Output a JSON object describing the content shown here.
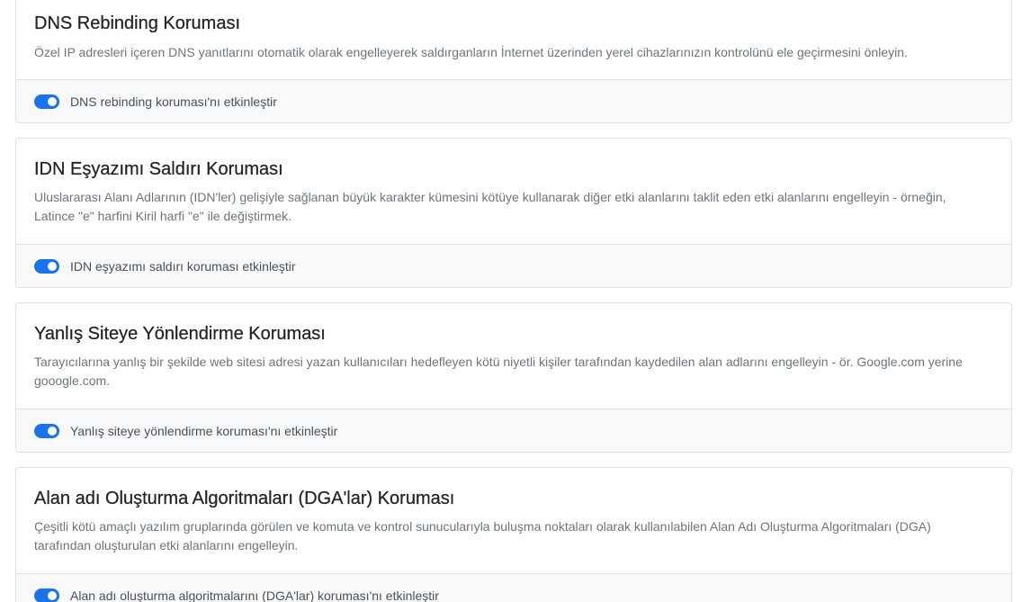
{
  "cards": [
    {
      "title": "DNS Rebinding Koruması",
      "description": "Özel IP adresleri içeren DNS yanıtlarını otomatik olarak engelleyerek saldırganların İnternet üzerinden yerel cihazlarınızın kontrolünü ele geçirmesini önleyin.",
      "toggle_label": "DNS rebinding koruması'nı etkinleştir",
      "enabled": true
    },
    {
      "title": "IDN Eşyazımı Saldırı Koruması",
      "description": "Uluslararası Alanı Adlarının (IDN'ler) gelişiyle sağlanan büyük karakter kümesini kötüye kullanarak diğer etki alanlarını taklit eden etki alanlarını engelleyin - örneğin, Latince \"e\" harfini Kiril harfi \"е\" ile değiştirmek.",
      "toggle_label": "IDN eşyazımı saldırı koruması etkinleştir",
      "enabled": true
    },
    {
      "title": "Yanlış Siteye Yönlendirme Koruması",
      "description": "Tarayıcılarına yanlış bir şekilde web sitesi adresi yazan kullanıcıları hedefleyen kötü niyetli kişiler tarafından kaydedilen alan adlarını engelleyin - ör. Google.com yerine gooogle.com.",
      "toggle_label": "Yanlış siteye yönlendirme koruması'nı etkinleştir",
      "enabled": true
    },
    {
      "title": "Alan adı Oluşturma Algoritmaları (DGA'lar) Koruması",
      "description": "Çeşitli kötü amaçlı yazılım gruplarında görülen ve komuta ve kontrol sunucularıyla buluşma noktaları olarak kullanılabilen Alan Adı Oluşturma Algoritmaları (DGA) tarafından oluşturulan etki alanlarını engelleyin.",
      "toggle_label": "Alan adı oluşturma algoritmalarını (DGA'lar) koruması'nı etkinleştir",
      "enabled": true
    }
  ],
  "colors": {
    "toggle_on": "#1a73e8",
    "footer_bg": "#f8f9fa",
    "border": "#dee2e6",
    "description": "#6c757d"
  }
}
